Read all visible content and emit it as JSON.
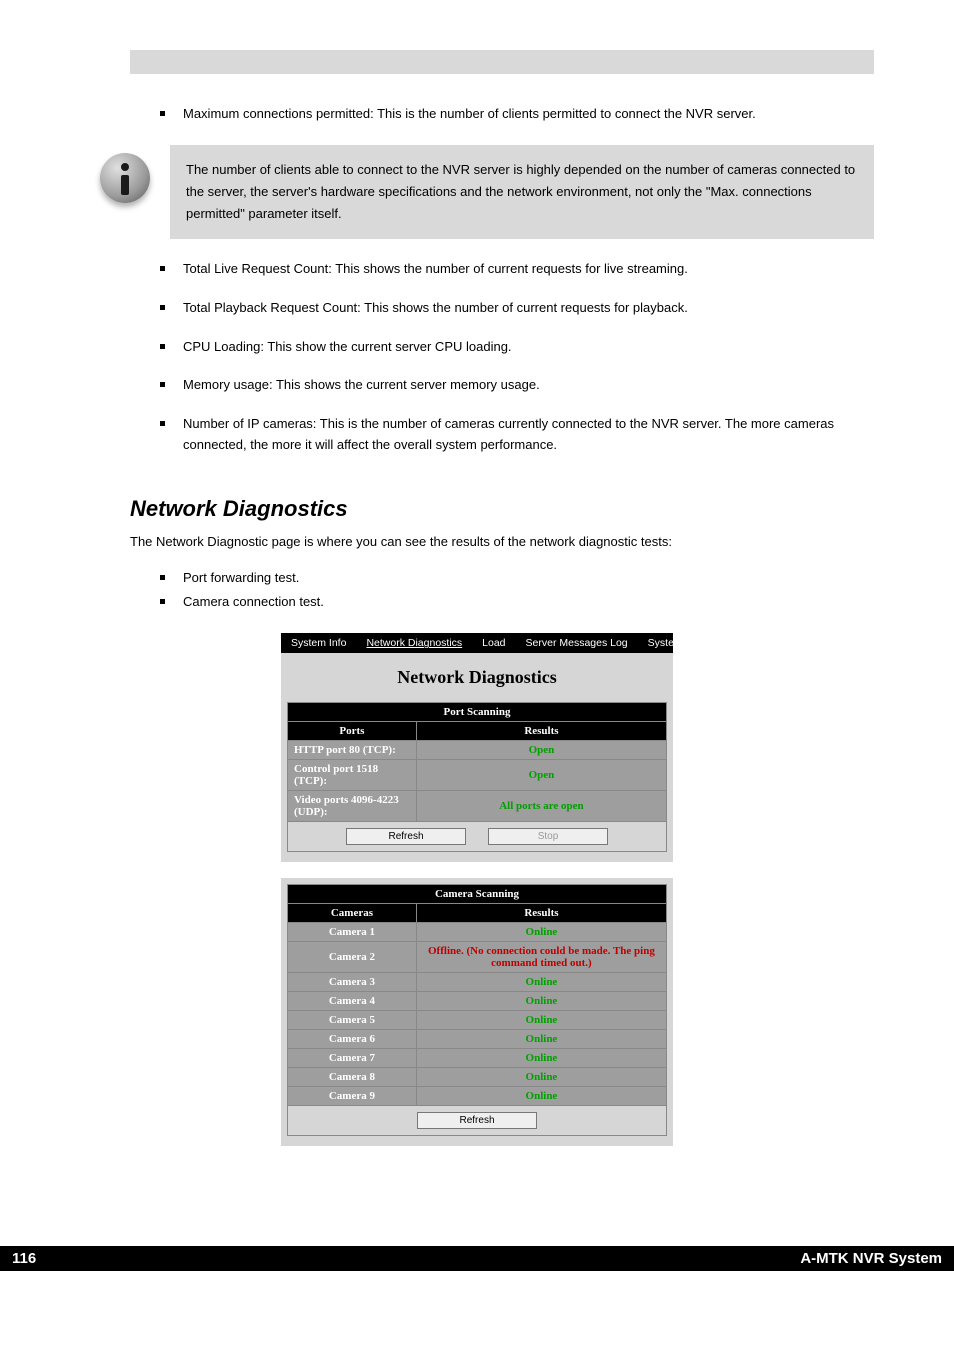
{
  "bullets": {
    "pre_info": "Maximum connections permitted: This is the number of clients permitted to connect the NVR server.",
    "info_text": "The number of clients able to connect to the NVR server is highly depended on the number of cameras connected to the server, the server's hardware specifications and the network environment, not only the \"Max. connections permitted\" parameter itself.",
    "post_info": [
      "Total Live Request Count: This shows the number of current requests for live streaming.",
      "Total Playback Request Count: This shows the number of current requests for playback.",
      "CPU Loading: This show the current server CPU loading.",
      "Memory usage: This shows the current server memory usage.",
      "Number of IP cameras: This is the number of cameras currently connected to the NVR server. The more cameras connected, the more it will affect the overall system performance."
    ]
  },
  "section": {
    "heading": "Network Diagnostics",
    "para": "The Network Diagnostic page is where you can see the results of the network diagnostic tests:",
    "list": [
      "Port forwarding test.",
      "Camera connection test."
    ]
  },
  "screenshot": {
    "tabs": [
      "System Info",
      "Network Diagnostics",
      "Load",
      "Server Messages Log",
      "System Downloads"
    ],
    "active_tab": "Network Diagnostics",
    "title": "Network Diagnostics",
    "port_panel": {
      "header": "Port Scanning",
      "col1": "Ports",
      "col2": "Results",
      "rows": [
        {
          "label": "HTTP port 80 (TCP):",
          "result": "Open",
          "status": "open"
        },
        {
          "label": "Control port 1518 (TCP):",
          "result": "Open",
          "status": "open"
        },
        {
          "label": "Video ports 4096-4223 (UDP):",
          "result": "All ports are open",
          "status": "open"
        }
      ],
      "buttons": {
        "refresh": "Refresh",
        "stop": "Stop"
      }
    },
    "cam_panel": {
      "header": "Camera Scanning",
      "col1": "Cameras",
      "col2": "Results",
      "rows": [
        {
          "label": "Camera 1",
          "result": "Online",
          "status": "open"
        },
        {
          "label": "Camera 2",
          "result": "Offline. (No connection could be made. The ping command timed out.)",
          "status": "offline"
        },
        {
          "label": "Camera 3",
          "result": "Online",
          "status": "open"
        },
        {
          "label": "Camera 4",
          "result": "Online",
          "status": "open"
        },
        {
          "label": "Camera 5",
          "result": "Online",
          "status": "open"
        },
        {
          "label": "Camera 6",
          "result": "Online",
          "status": "open"
        },
        {
          "label": "Camera 7",
          "result": "Online",
          "status": "open"
        },
        {
          "label": "Camera 8",
          "result": "Online",
          "status": "open"
        },
        {
          "label": "Camera 9",
          "result": "Online",
          "status": "open"
        }
      ],
      "buttons": {
        "refresh": "Refresh"
      }
    }
  },
  "footer": {
    "left": "116",
    "right": "A-MTK NVR System"
  }
}
